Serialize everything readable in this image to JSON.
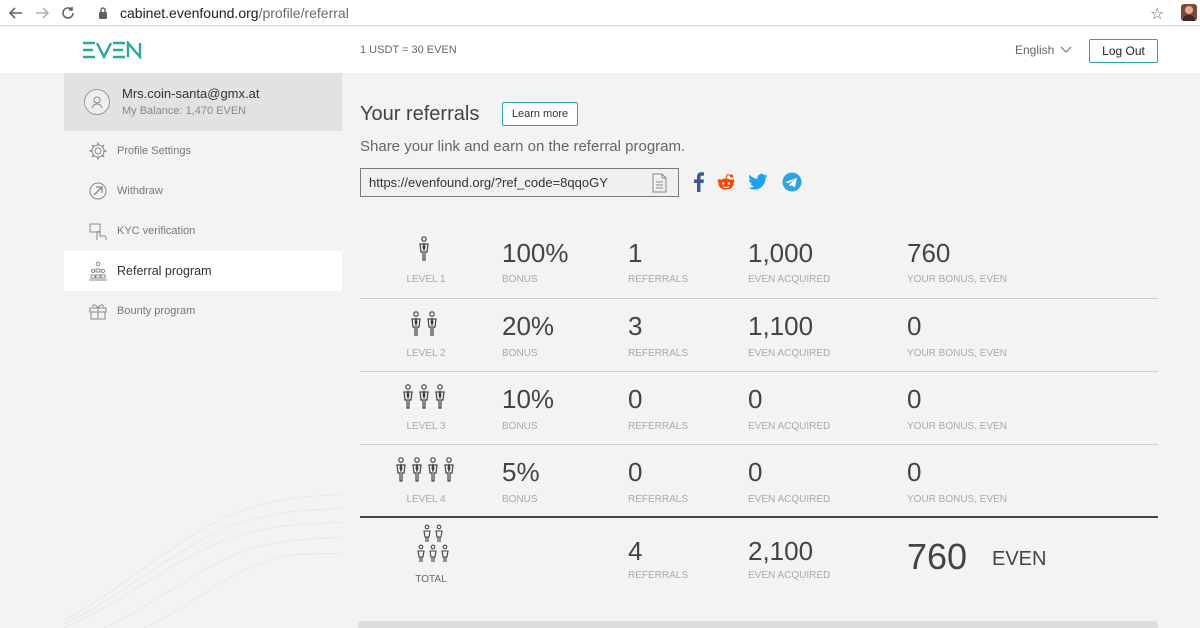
{
  "browser": {
    "url_host": "cabinet.evenfound.org",
    "url_path": "/profile/referral"
  },
  "header": {
    "rate": "1 USDT = 30 EVEN",
    "language": "English",
    "logout_label": "Log Out"
  },
  "user": {
    "email": "Mrs.coin-santa@gmx.at",
    "balance": "My Balance: 1,470 EVEN"
  },
  "sidebar": {
    "items": [
      {
        "label": "Profile Settings",
        "icon": "gear-icon"
      },
      {
        "label": "Withdraw",
        "icon": "withdraw-arrow-icon"
      },
      {
        "label": "KYC verification",
        "icon": "kyc-hand-icon"
      },
      {
        "label": "Referral program",
        "icon": "referral-people-icon",
        "active": true
      },
      {
        "label": "Bounty program",
        "icon": "gift-icon"
      }
    ]
  },
  "main": {
    "title": "Your referrals",
    "learn_more": "Learn more",
    "subtitle": "Share your link and earn on the referral program.",
    "ref_link": "https://evenfound.org/?ref_code=8qqoGY",
    "social": [
      "facebook-icon",
      "reddit-icon",
      "twitter-icon",
      "telegram-icon"
    ],
    "colors": {
      "accent": "#2aa89a",
      "facebook": "#3b5998",
      "reddit": "#ff4500",
      "twitter": "#1da1f2",
      "telegram": "#2ca5e0"
    }
  },
  "levels": [
    {
      "label": "LEVEL 1",
      "people": 1,
      "bonus": "100%",
      "bonus_label": "BONUS",
      "referrals": "1",
      "referrals_label": "REFERRALS",
      "acquired": "1,000",
      "acquired_label": "EVEN ACQUIRED",
      "your_bonus": "760",
      "your_bonus_label": "YOUR BONUS, EVEN"
    },
    {
      "label": "LEVEL 2",
      "people": 2,
      "bonus": "20%",
      "bonus_label": "BONUS",
      "referrals": "3",
      "referrals_label": "REFERRALS",
      "acquired": "1,100",
      "acquired_label": "EVEN ACQUIRED",
      "your_bonus": "0",
      "your_bonus_label": "YOUR BONUS, EVEN"
    },
    {
      "label": "LEVEL 3",
      "people": 3,
      "bonus": "10%",
      "bonus_label": "BONUS",
      "referrals": "0",
      "referrals_label": "REFERRALS",
      "acquired": "0",
      "acquired_label": "EVEN ACQUIRED",
      "your_bonus": "0",
      "your_bonus_label": "YOUR BONUS, EVEN"
    },
    {
      "label": "LEVEL 4",
      "people": 4,
      "bonus": "5%",
      "bonus_label": "BONUS",
      "referrals": "0",
      "referrals_label": "REFERRALS",
      "acquired": "0",
      "acquired_label": "EVEN ACQUIRED",
      "your_bonus": "0",
      "your_bonus_label": "YOUR BONUS, EVEN"
    }
  ],
  "total": {
    "label": "TOTAL",
    "referrals": "4",
    "referrals_label": "REFERRALS",
    "acquired": "2,100",
    "acquired_label": "EVEN ACQUIRED",
    "bonus": "760",
    "bonus_unit": "EVEN"
  }
}
